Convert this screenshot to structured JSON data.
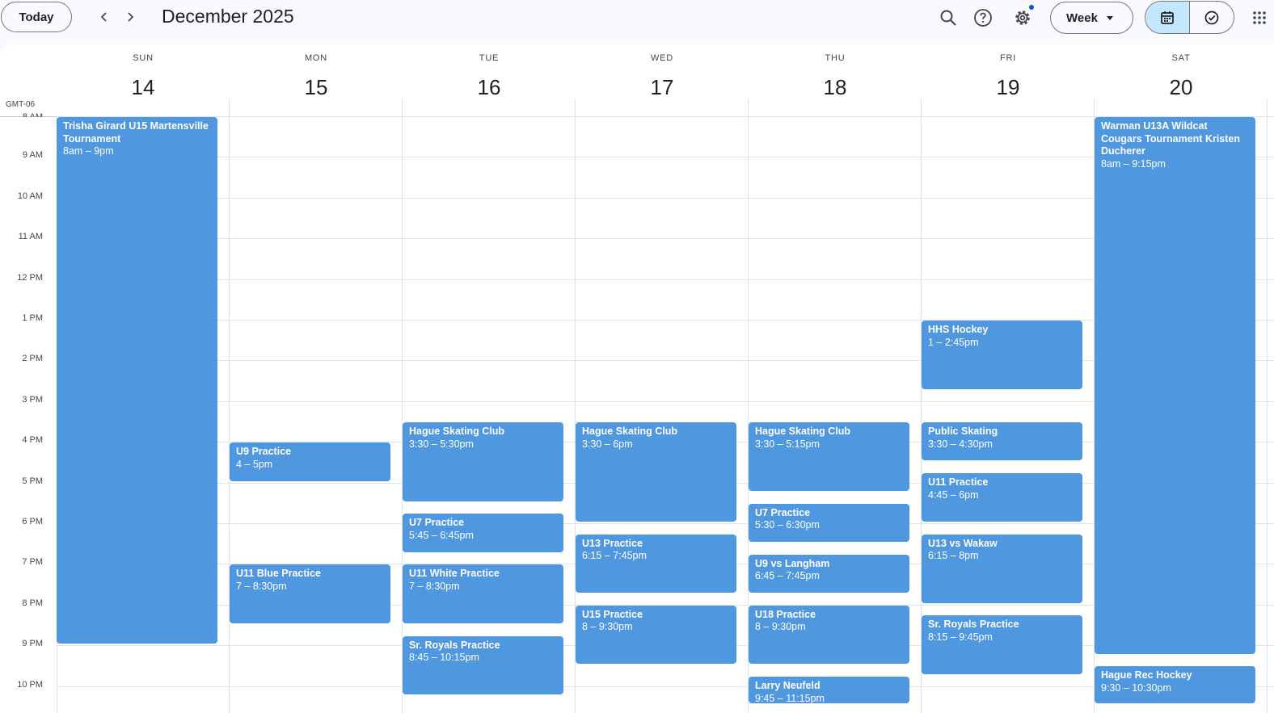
{
  "toolbar": {
    "today_label": "Today",
    "month_title": "December 2025",
    "view_label": "Week"
  },
  "timezone": "GMT-06",
  "days": [
    {
      "dow": "SUN",
      "date": "14"
    },
    {
      "dow": "MON",
      "date": "15"
    },
    {
      "dow": "TUE",
      "date": "16"
    },
    {
      "dow": "WED",
      "date": "17"
    },
    {
      "dow": "THU",
      "date": "18"
    },
    {
      "dow": "FRI",
      "date": "19"
    },
    {
      "dow": "SAT",
      "date": "20"
    }
  ],
  "hours": [
    "8 AM",
    "9 AM",
    "10 AM",
    "11 AM",
    "12 PM",
    "1 PM",
    "2 PM",
    "3 PM",
    "4 PM",
    "5 PM",
    "6 PM",
    "7 PM",
    "8 PM",
    "9 PM",
    "10 PM"
  ],
  "events": [
    {
      "day": 0,
      "start": 8.0,
      "end": 21.0,
      "title": "Trisha Girard U15 Martensville Tournament",
      "when": "8am – 9pm"
    },
    {
      "day": 1,
      "start": 16.0,
      "end": 17.0,
      "title": "U9 Practice",
      "when": "4 – 5pm"
    },
    {
      "day": 1,
      "start": 19.0,
      "end": 20.5,
      "title": "U11 Blue Practice",
      "when": "7 – 8:30pm"
    },
    {
      "day": 2,
      "start": 15.5,
      "end": 17.5,
      "title": "Hague Skating Club",
      "when": "3:30 – 5:30pm"
    },
    {
      "day": 2,
      "start": 17.75,
      "end": 18.75,
      "title": "U7 Practice",
      "when": "5:45 – 6:45pm"
    },
    {
      "day": 2,
      "start": 19.0,
      "end": 20.5,
      "title": "U11 White Practice",
      "when": "7 – 8:30pm"
    },
    {
      "day": 2,
      "start": 20.75,
      "end": 22.25,
      "title": "Sr. Royals Practice",
      "when": "8:45 – 10:15pm"
    },
    {
      "day": 3,
      "start": 15.5,
      "end": 18.0,
      "title": "Hague Skating Club",
      "when": "3:30 – 6pm"
    },
    {
      "day": 3,
      "start": 18.25,
      "end": 19.75,
      "title": "U13 Practice",
      "when": "6:15 – 7:45pm"
    },
    {
      "day": 3,
      "start": 20.0,
      "end": 21.5,
      "title": "U15 Practice",
      "when": "8 – 9:30pm"
    },
    {
      "day": 4,
      "start": 15.5,
      "end": 17.25,
      "title": "Hague Skating Club",
      "when": "3:30 – 5:15pm"
    },
    {
      "day": 4,
      "start": 17.5,
      "end": 18.5,
      "title": "U7 Practice",
      "when": "5:30 – 6:30pm"
    },
    {
      "day": 4,
      "start": 18.75,
      "end": 19.75,
      "title": "U9 vs Langham",
      "when": "6:45 – 7:45pm"
    },
    {
      "day": 4,
      "start": 20.0,
      "end": 21.5,
      "title": "U18 Practice",
      "when": "8 – 9:30pm"
    },
    {
      "day": 4,
      "start": 21.75,
      "end": 23.25,
      "title": "Larry Neufeld",
      "when": "9:45 – 11:15pm"
    },
    {
      "day": 5,
      "start": 13.0,
      "end": 14.75,
      "title": "HHS Hockey",
      "when": "1 – 2:45pm"
    },
    {
      "day": 5,
      "start": 15.5,
      "end": 16.5,
      "title": "Public Skating",
      "when": "3:30 – 4:30pm"
    },
    {
      "day": 5,
      "start": 16.75,
      "end": 18.0,
      "title": "U11 Practice",
      "when": "4:45 – 6pm"
    },
    {
      "day": 5,
      "start": 18.25,
      "end": 20.0,
      "title": "U13 vs Wakaw",
      "when": "6:15 – 8pm"
    },
    {
      "day": 5,
      "start": 20.25,
      "end": 21.75,
      "title": "Sr. Royals Practice",
      "when": "8:15 – 9:45pm"
    },
    {
      "day": 6,
      "start": 8.0,
      "end": 21.25,
      "title": "Warman U13A Wildcat Cougars Tournament Kristen Ducherer",
      "when": "8am – 9:15pm"
    },
    {
      "day": 6,
      "start": 21.5,
      "end": 22.5,
      "title": "Hague Rec Hockey",
      "when": "9:30 – 10:30pm"
    }
  ],
  "colors": {
    "event_bg": "#4f98df",
    "selected_segment": "#c2e7ff",
    "notification_dot": "#0b57d0"
  }
}
